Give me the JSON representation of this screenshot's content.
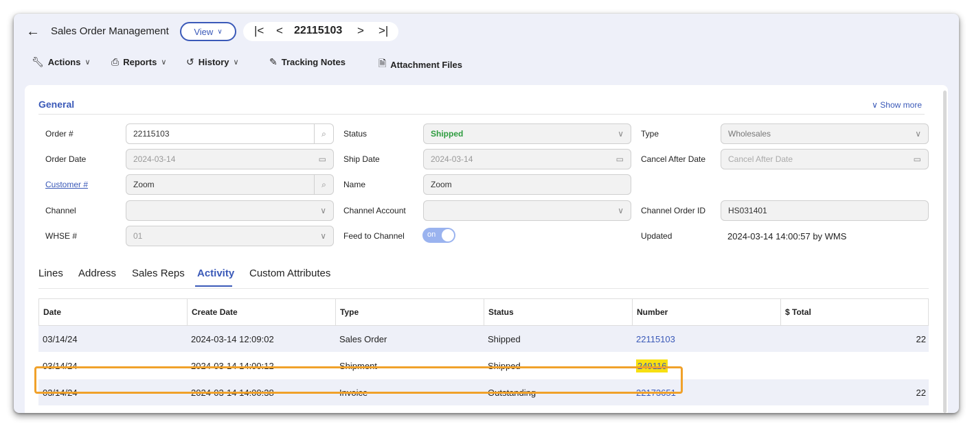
{
  "header": {
    "back_icon": "arrow-left-icon",
    "title": "Sales Order Management",
    "view_label": "View",
    "record_number": "22115103"
  },
  "toolbar": {
    "actions": "Actions",
    "reports": "Reports",
    "history": "History",
    "tracking_notes": "Tracking Notes",
    "attachment_files": "Attachment Files"
  },
  "general": {
    "title": "General",
    "show_more": "Show more",
    "order_label": "Order #",
    "order_value": "22115103",
    "order_date_label": "Order Date",
    "order_date_value": "2024-03-14",
    "customer_label": "Customer #",
    "customer_value": "Zoom",
    "channel_label": "Channel",
    "channel_value": "",
    "whse_label": "WHSE #",
    "whse_value": "01",
    "status_label": "Status",
    "status_value": "Shipped",
    "ship_date_label": "Ship Date",
    "ship_date_value": "2024-03-14",
    "name_label": "Name",
    "name_value": "Zoom",
    "channel_account_label": "Channel Account",
    "channel_account_value": "",
    "feed_label": "Feed to Channel",
    "feed_value": "on",
    "type_label": "Type",
    "type_value": "Wholesales",
    "cancel_label": "Cancel After Date",
    "cancel_placeholder": "Cancel After Date",
    "channel_order_label": "Channel Order ID",
    "channel_order_value": "HS031401",
    "updated_label": "Updated",
    "updated_value": "2024-03-14 14:00:57 by WMS"
  },
  "tabs": [
    "Lines",
    "Address",
    "Sales Reps",
    "Activity",
    "Custom Attributes"
  ],
  "active_tab": "Activity",
  "table": {
    "headers": [
      "Date",
      "Create Date",
      "Type",
      "Status",
      "Number",
      "$ Total"
    ],
    "rows": [
      [
        "03/14/24",
        "2024-03-14 12:09:02",
        "Sales Order",
        "Shipped",
        "22115103",
        "22"
      ],
      [
        "03/14/24",
        "2024-03-14 14:00:12",
        "Shipment",
        "Shipped",
        "249116",
        ""
      ],
      [
        "03/14/24",
        "2024-03-14 14:00:38",
        "Invoice",
        "Outstanding",
        "22173651",
        "22"
      ]
    ]
  },
  "colors": {
    "accent": "#3a59b8",
    "shipped": "#2e9c3f",
    "highlight": "#f7e012",
    "highlight_border": "#f0a12a"
  }
}
